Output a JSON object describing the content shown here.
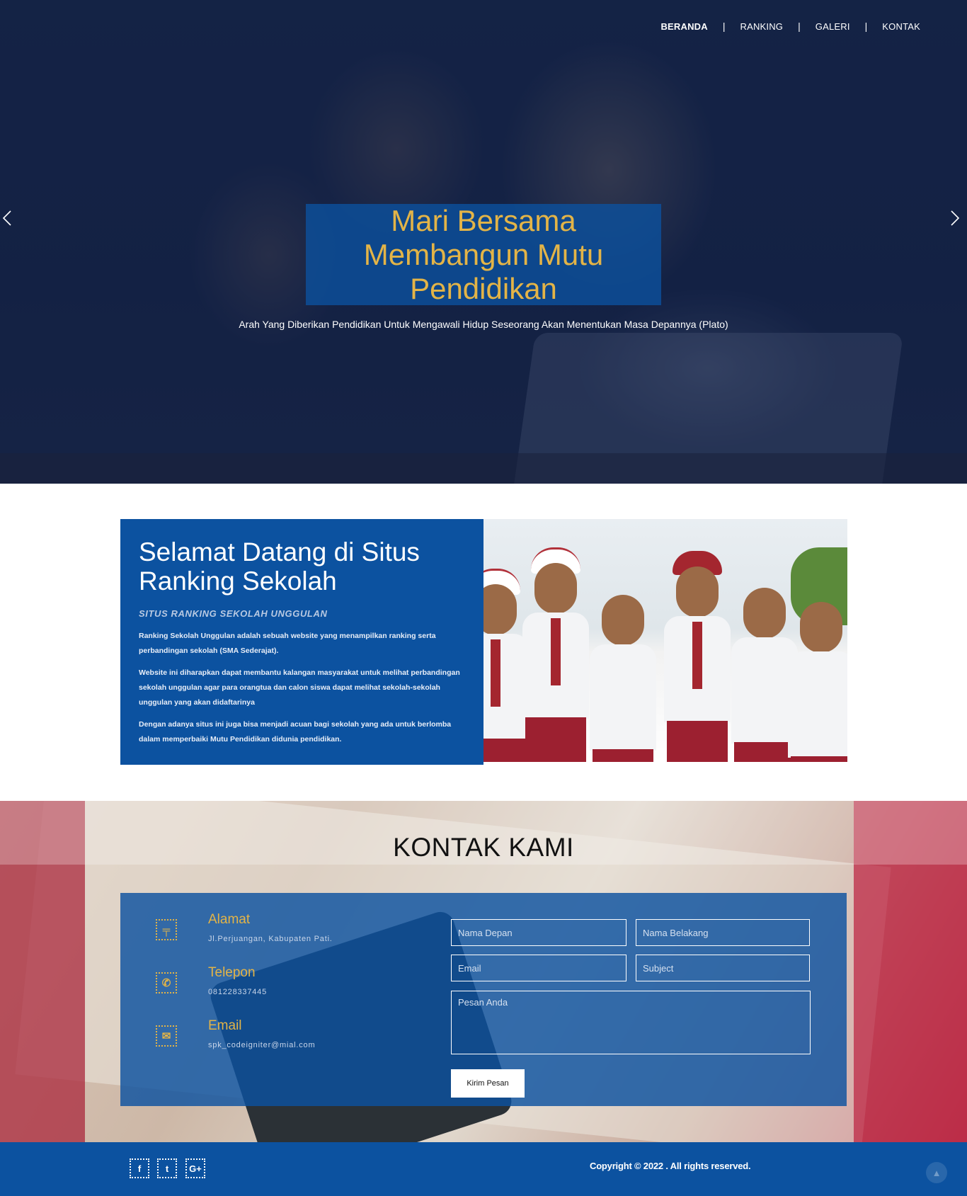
{
  "nav": {
    "items": [
      {
        "label": "BERANDA",
        "active": true
      },
      {
        "label": "RANKING",
        "active": false
      },
      {
        "label": "GALERI",
        "active": false
      },
      {
        "label": "KONTAK",
        "active": false
      }
    ],
    "separator": "|"
  },
  "hero": {
    "title": "Mari Bersama Membangun Mutu Pendidikan",
    "quote": "Arah Yang Diberikan Pendidikan Untuk Mengawali Hidup Seseorang Akan Menentukan Masa Depannya (Plato)",
    "prev_icon": "chevron-left-icon",
    "next_icon": "chevron-right-icon"
  },
  "about": {
    "title": "Selamat Datang di Situs Ranking Sekolah",
    "subtitle": "SITUS RANKING SEKOLAH UNGGULAN",
    "paragraphs": [
      "Ranking Sekolah Unggulan adalah sebuah website yang menampilkan ranking serta perbandingan sekolah (SMA Sederajat).",
      "Website ini diharapkan dapat membantu kalangan masyarakat untuk melihat perbandingan sekolah unggulan agar para orangtua dan calon siswa dapat melihat sekolah-sekolah unggulan yang akan didaftarinya",
      "Dengan adanya situs ini juga bisa menjadi acuan bagi sekolah yang ada untuk berlomba dalam memperbaiki Mutu Pendidikan didunia pendidikan."
    ]
  },
  "contact": {
    "title": "KONTAK KAMI",
    "info": [
      {
        "title": "Alamat",
        "text": "Jl.Perjuangan, Kabupaten Pati.",
        "icon": "signpost-icon",
        "glyph": "╤"
      },
      {
        "title": "Telepon",
        "text": "081228337445",
        "icon": "phone-icon",
        "glyph": "✆"
      },
      {
        "title": "Email",
        "text": "spk_codeigniter@mial.com",
        "icon": "envelope-icon",
        "glyph": "✉"
      }
    ],
    "form": {
      "first_name_placeholder": "Nama Depan",
      "last_name_placeholder": "Nama Belakang",
      "email_placeholder": "Email",
      "subject_placeholder": "Subject",
      "message_placeholder": "Pesan Anda",
      "submit_label": "Kirim Pesan"
    }
  },
  "footer": {
    "social": [
      {
        "icon": "facebook-icon",
        "glyph": "f"
      },
      {
        "icon": "twitter-icon",
        "glyph": "t"
      },
      {
        "icon": "google-plus-icon",
        "glyph": "G+"
      }
    ],
    "copyright": "Copyright © 2022 . All rights reserved.",
    "to_top_icon": "arrow-up-icon"
  },
  "colors": {
    "primary_blue": "#0c52a0",
    "accent_gold": "#e3b447"
  }
}
